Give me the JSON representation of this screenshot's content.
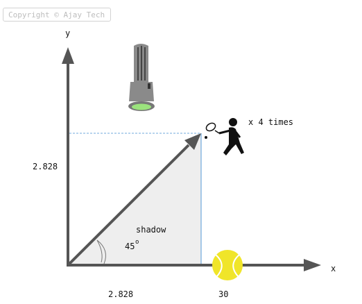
{
  "watermark": "Copyright © Ajay Tech",
  "axes": {
    "x_label": "x",
    "y_label": "y"
  },
  "labels": {
    "vertical_value": "2.828",
    "horizontal_value": "2.828",
    "ball_value": "30",
    "multiplier": "x 4 times",
    "shadow": "shadow",
    "angle": "45",
    "degree": "o"
  },
  "icons": {
    "light": "flashlight-icon",
    "player": "tennis-player-icon",
    "ball": "tennis-ball-icon",
    "angle_arc": "angle-arc-icon"
  },
  "colors": {
    "axis": "#555555",
    "shadow_fill": "#eeeeee",
    "guide_line": "#6fa8dc",
    "ball": "#f0e529",
    "flashlight_body": "#8a8a8a",
    "lens": "#9be37d"
  }
}
